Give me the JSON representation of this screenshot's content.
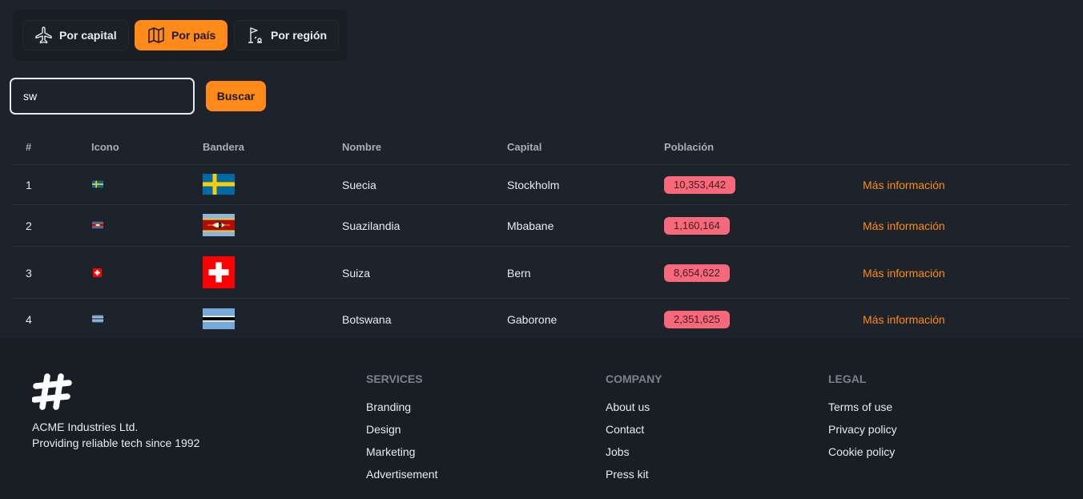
{
  "tabs": [
    {
      "label": "Por capital",
      "icon": "airplane-icon",
      "active": false
    },
    {
      "label": "Por país",
      "icon": "map-icon",
      "active": true
    },
    {
      "label": "Por región",
      "icon": "flag-location-icon",
      "active": false
    }
  ],
  "search": {
    "value": "sw",
    "button_label": "Buscar"
  },
  "table": {
    "headers": [
      "#",
      "Icono",
      "Bandera",
      "Nombre",
      "Capital",
      "Población"
    ],
    "rows": [
      {
        "num": "1",
        "name": "Suecia",
        "capital": "Stockholm",
        "population": "10,353,442",
        "more": "Más información",
        "flag": "sweden-flag"
      },
      {
        "num": "2",
        "name": "Suazilandia",
        "capital": "Mbabane",
        "population": "1,160,164",
        "more": "Más información",
        "flag": "eswatini-flag"
      },
      {
        "num": "3",
        "name": "Suiza",
        "capital": "Bern",
        "population": "8,654,622",
        "more": "Más información",
        "flag": "switzerland-flag"
      },
      {
        "num": "4",
        "name": "Botswana",
        "capital": "Gaborone",
        "population": "2,351,625",
        "more": "Más información",
        "flag": "botswana-flag"
      }
    ]
  },
  "footer": {
    "company_name": "ACME Industries Ltd.",
    "tagline": "Providing reliable tech since 1992",
    "columns": [
      {
        "title": "SERVICES",
        "links": [
          "Branding",
          "Design",
          "Marketing",
          "Advertisement"
        ]
      },
      {
        "title": "COMPANY",
        "links": [
          "About us",
          "Contact",
          "Jobs",
          "Press kit"
        ]
      },
      {
        "title": "LEGAL",
        "links": [
          "Terms of use",
          "Privacy policy",
          "Cookie policy"
        ]
      }
    ]
  },
  "colors": {
    "accent": "#ff8a1a",
    "badge": "#f7687a",
    "background": "#1d232a",
    "footer": "#191e24"
  }
}
